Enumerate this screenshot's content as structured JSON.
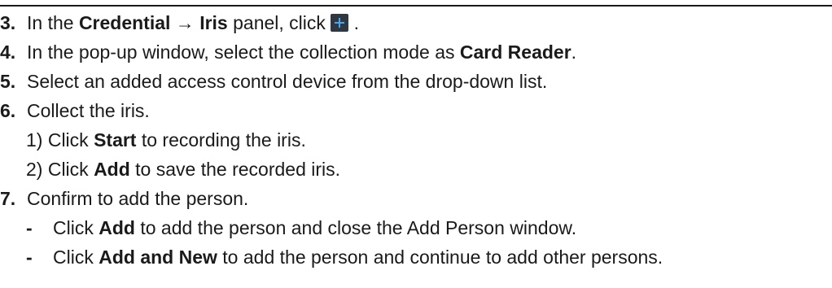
{
  "steps": [
    {
      "number": "3.",
      "segments": {
        "t1": "In the ",
        "b1": "Credential → Iris",
        "t2": " panel, click ",
        "t3": " ."
      },
      "icon": "plus-icon"
    },
    {
      "number": "4.",
      "segments": {
        "t1": "In the pop-up window, select the collection mode as ",
        "b1": "Card Reader",
        "t2": "."
      }
    },
    {
      "number": "5.",
      "segments": {
        "t1": "Select an added access control device from the drop-down list."
      }
    },
    {
      "number": "6.",
      "segments": {
        "t1": "Collect the iris."
      },
      "substeps": [
        {
          "prefix": "1) Click ",
          "bold": "Start",
          "suffix": " to recording the iris."
        },
        {
          "prefix": "2) Click ",
          "bold": "Add",
          "suffix": " to save the recorded iris."
        }
      ]
    },
    {
      "number": "7.",
      "segments": {
        "t1": "Confirm to add the person."
      },
      "bullets": [
        {
          "dash": "-",
          "prefix": "Click ",
          "bold": "Add",
          "suffix": " to add the person and close the Add Person window."
        },
        {
          "dash": "-",
          "prefix": "Click ",
          "bold": "Add and New",
          "suffix": " to add the person and continue to add other persons."
        }
      ]
    }
  ],
  "colors": {
    "text": "#1a1a1a",
    "icon_bg": "#2f3742",
    "icon_plus": "#4aa8e8"
  }
}
